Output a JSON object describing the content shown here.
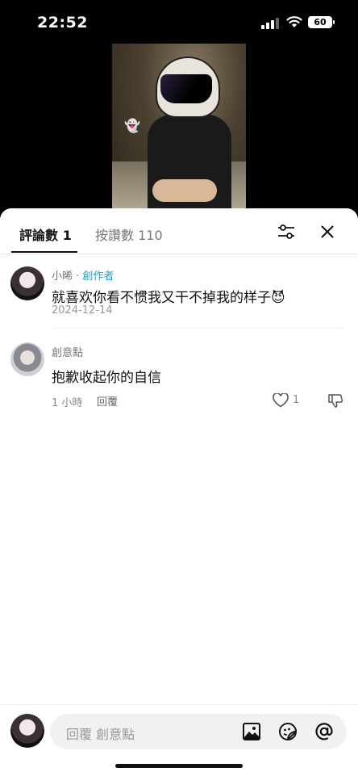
{
  "status_bar": {
    "time": "22:52",
    "battery": "60"
  },
  "sheet": {
    "tabs": [
      {
        "label": "評論數 1",
        "active": true
      },
      {
        "label": "按讚數 110",
        "active": false
      }
    ],
    "comments": [
      {
        "author": "小晞",
        "separator": " · ",
        "badge": "創作者",
        "text": "就喜欢你看不惯我又干不掉我的样子😈",
        "date": "2024-12-14"
      },
      {
        "author": "創意點",
        "text": "抱歉收起你的自信",
        "time_ago": "1 小時",
        "reply_label": "回覆",
        "likes": "1"
      }
    ],
    "input": {
      "placeholder": "回覆 創意點"
    }
  },
  "video": {
    "sticker": "👻"
  },
  "colors": {
    "accent": "#1aa3d4"
  },
  "icons": [
    "filter-icon",
    "close-icon",
    "heart-icon",
    "dislike-icon",
    "image-icon",
    "sticker-icon",
    "mention-icon"
  ]
}
